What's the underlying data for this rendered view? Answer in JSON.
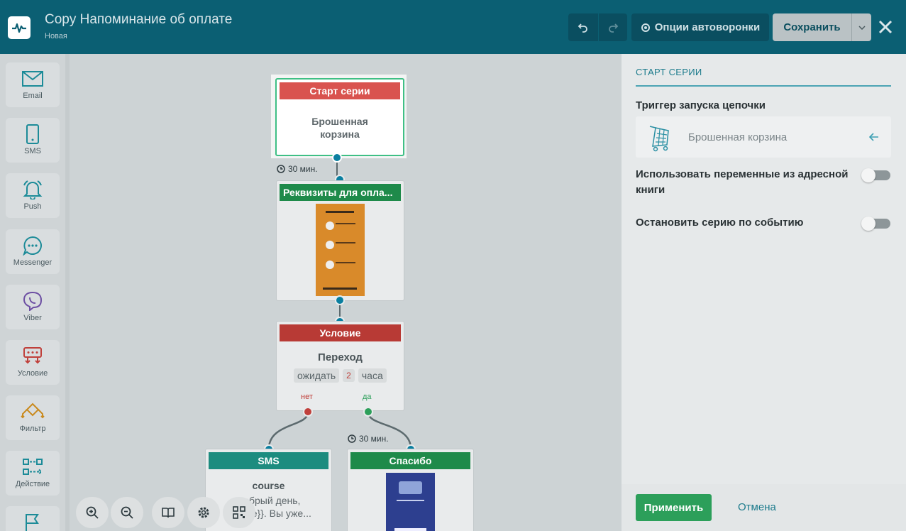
{
  "header": {
    "title": "Copy Напоминание об оплате",
    "status": "Новая",
    "options_label": "Опции автоворонки",
    "save_label": "Сохранить"
  },
  "sidebar": {
    "items": [
      {
        "label": "Email",
        "icon": "email-icon"
      },
      {
        "label": "SMS",
        "icon": "phone-icon"
      },
      {
        "label": "Push",
        "icon": "bell-icon"
      },
      {
        "label": "Messenger",
        "icon": "chat-icon"
      },
      {
        "label": "Viber",
        "icon": "viber-icon"
      },
      {
        "label": "Условие",
        "icon": "condition-icon"
      },
      {
        "label": "Фильтр",
        "icon": "filter-icon"
      },
      {
        "label": "Действие",
        "icon": "action-icon"
      }
    ]
  },
  "canvas": {
    "start": {
      "header": "Старт серии",
      "body": "Брошенная корзина"
    },
    "delay1": "30 мин.",
    "email_node": {
      "header": "Реквизиты для опла..."
    },
    "condition": {
      "header": "Условие",
      "title": "Переход",
      "wait_label": "ожидать",
      "wait_value": "2",
      "wait_unit": "часа",
      "no_label": "нет",
      "yes_label": "да"
    },
    "delay2": "30 мин.",
    "sms_node": {
      "header": "SMS",
      "title": "course",
      "line1": "Добрый день,",
      "line2": "{{name}}. Вы уже..."
    },
    "thanks_node": {
      "header": "Спасибо"
    }
  },
  "panel": {
    "section_title": "СТАРТ СЕРИИ",
    "trigger_label": "Триггер запуска цепочки",
    "trigger_value": "Брошенная корзина",
    "option1": "Использовать переменные из адресной книги",
    "option1_on": false,
    "option2": "Остановить серию по событию",
    "option2_on": false,
    "apply_label": "Применить",
    "cancel_label": "Отмена"
  },
  "colors": {
    "header_bg": "#0b5f73",
    "start_red": "#d9534f",
    "email_green": "#1e8a4a",
    "condition_red": "#b83a35",
    "sms_teal": "#1d8c7f",
    "apply_green": "#2c9f5a",
    "connector_blue": "#0a7fa0"
  }
}
